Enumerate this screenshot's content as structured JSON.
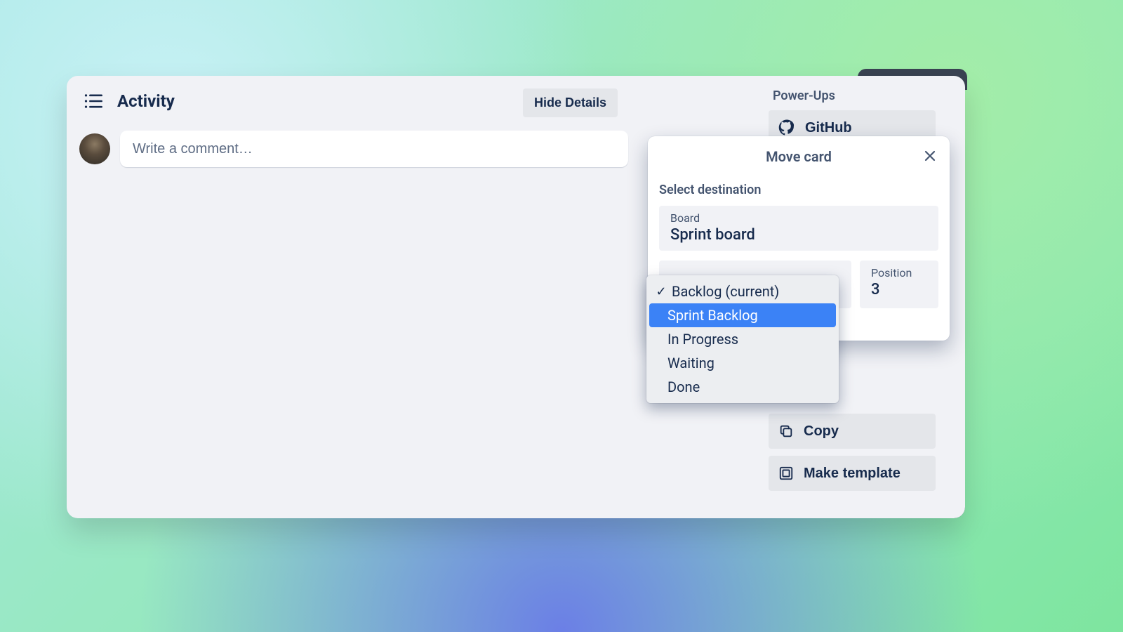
{
  "activity": {
    "title": "Activity",
    "hide_details": "Hide Details",
    "comment_placeholder": "Write a comment…"
  },
  "sidebar": {
    "powerups_label": "Power-Ups",
    "github": "GitHub",
    "copy": "Copy",
    "make_template": "Make template"
  },
  "move": {
    "title": "Move card",
    "select_destination": "Select destination",
    "board_label": "Board",
    "board_value": "Sprint board",
    "position_label": "Position",
    "position_value": "3",
    "list_options": [
      {
        "label": "Backlog (current)",
        "current": true,
        "highlight": false
      },
      {
        "label": "Sprint Backlog",
        "current": false,
        "highlight": true
      },
      {
        "label": "In Progress",
        "current": false,
        "highlight": false
      },
      {
        "label": "Waiting",
        "current": false,
        "highlight": false
      },
      {
        "label": "Done",
        "current": false,
        "highlight": false
      }
    ]
  }
}
